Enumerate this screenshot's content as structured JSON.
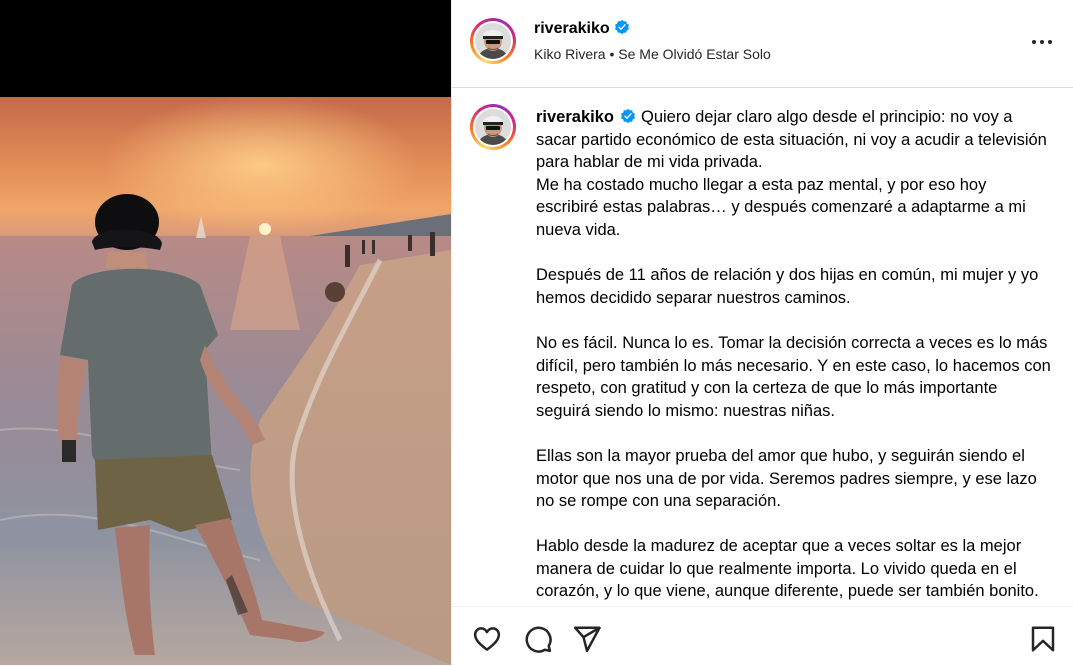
{
  "post": {
    "username": "riverakiko",
    "subtitle_author": "Kiko Rivera",
    "subtitle_separator": " • ",
    "subtitle_song": "Se Me Olvidó Estar Solo",
    "caption": "Quiero dejar claro algo desde el principio: no voy a sacar partido económico de esta situación, ni voy a acudir a televisión para hablar de mi vida privada.\nMe ha costado mucho llegar a esta paz mental, y por eso hoy escribiré estas palabras… y después comenzaré a adaptarme a mi nueva vida.\n\nDespués de 11 años de relación y dos hijas en común, mi mujer y yo hemos decidido separar nuestros caminos.\n\nNo es fácil. Nunca lo es. Tomar la decisión correcta a veces es lo más difícil, pero también lo más necesario. Y en este caso, lo hacemos con respeto, con gratitud y con la certeza de que lo más importante seguirá siendo lo mismo: nuestras niñas.\n\nEllas son la mayor prueba del amor que hubo, y seguirán siendo el motor que nos una de por vida. Seremos padres siempre, y ese lazo no se rompe con una separación.\n\nHablo desde la madurez de aceptar que a veces soltar es la mejor manera de cuidar lo que realmente importa. Lo vivido queda en el corazón, y lo que viene, aunque diferente, puede ser también bonito."
  },
  "icons": {
    "verified": "verified-badge-icon",
    "more": "more-options-icon",
    "like": "heart-icon",
    "comment": "comment-icon",
    "share": "send-icon",
    "save": "bookmark-icon"
  },
  "colors": {
    "verified_blue": "#0095f6",
    "border": "#dbdbdb"
  }
}
